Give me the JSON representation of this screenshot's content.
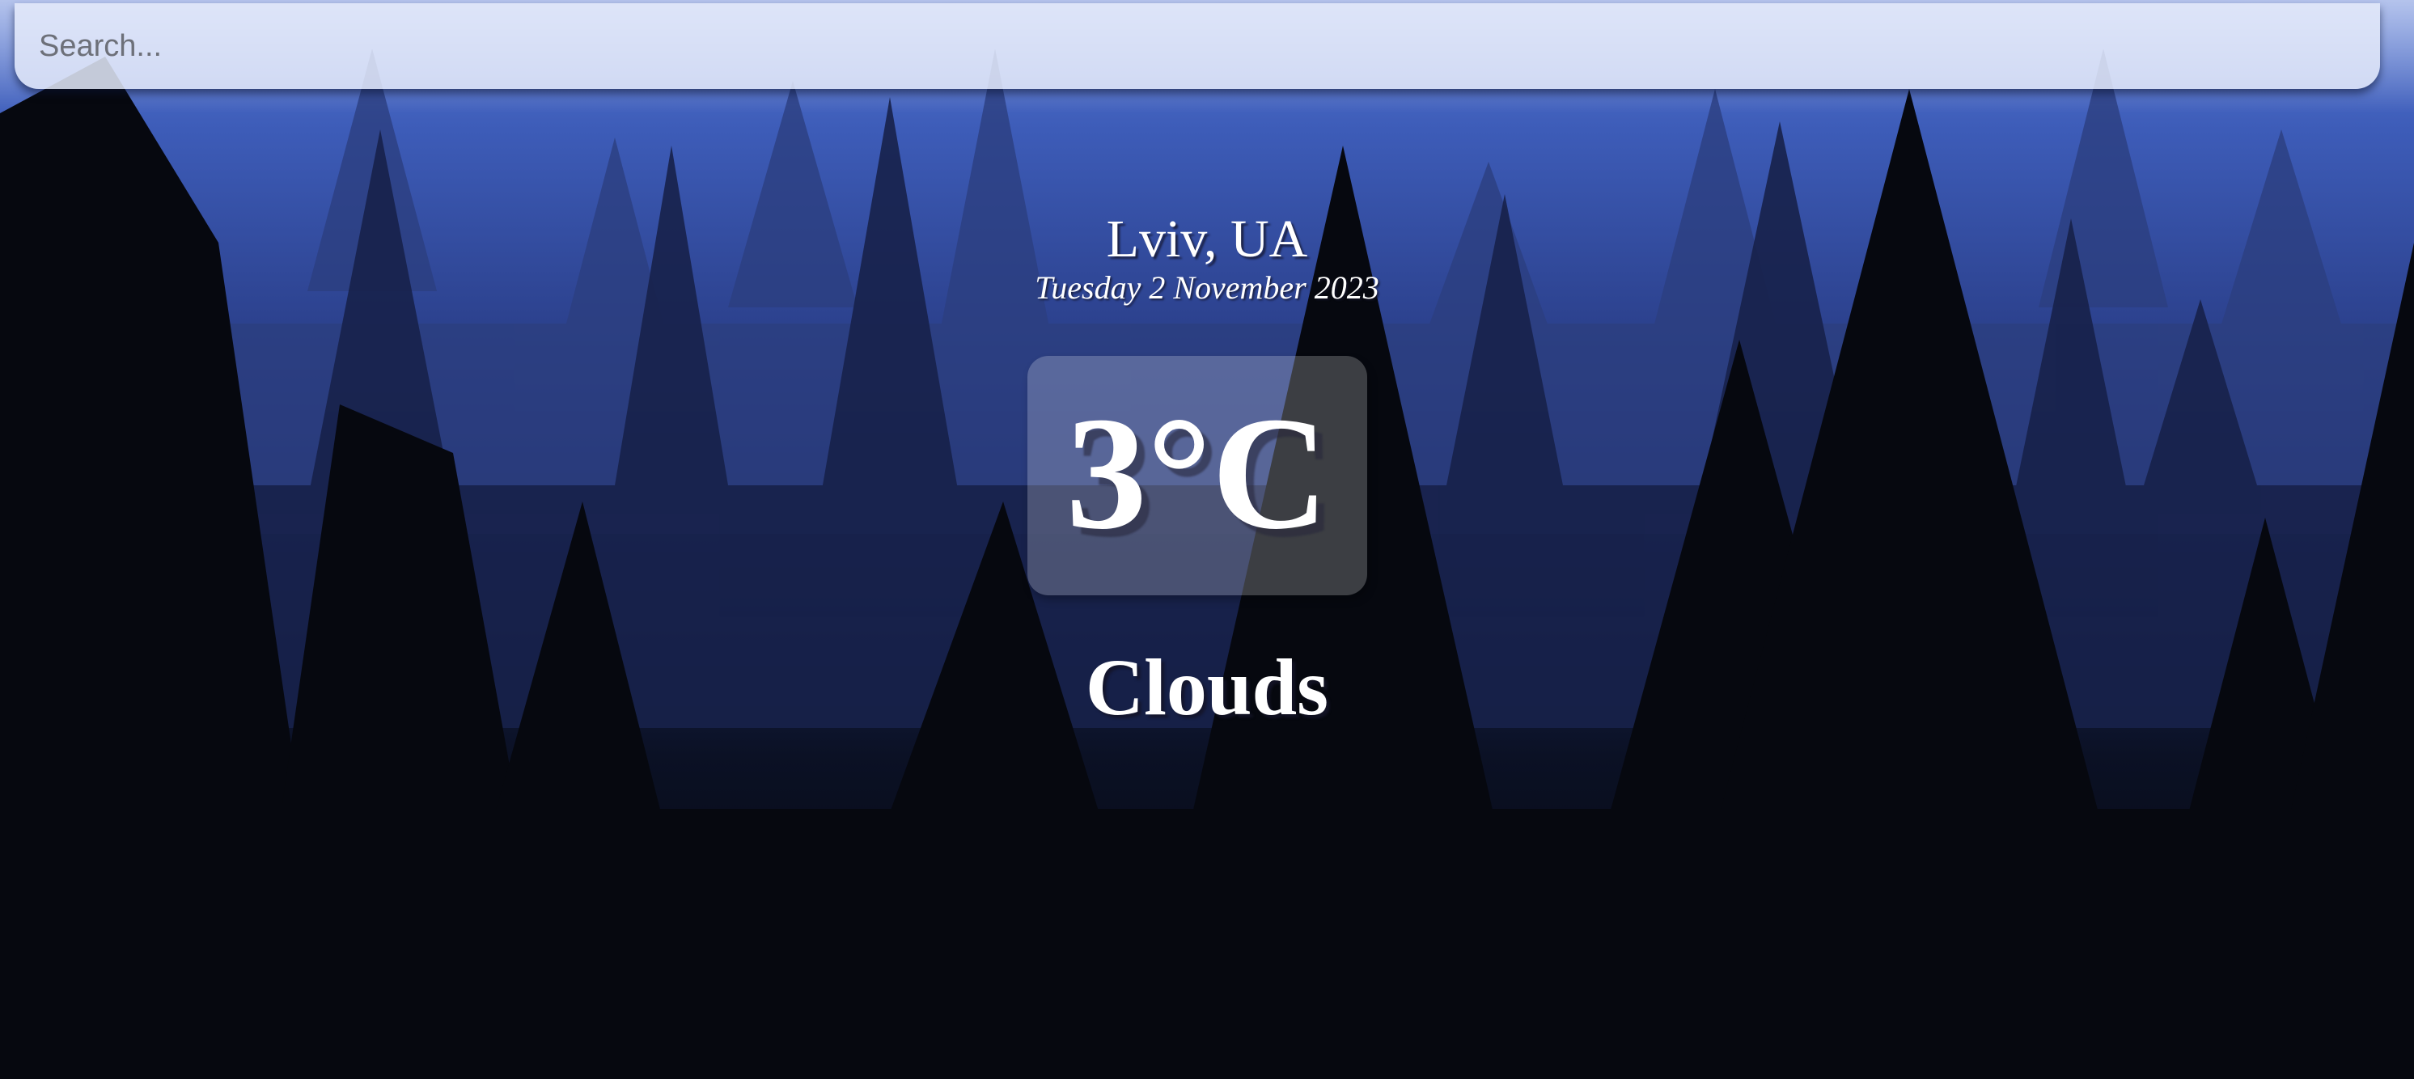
{
  "search": {
    "placeholder": "Search...",
    "value": ""
  },
  "weather": {
    "location": "Lviv, UA",
    "date": "Tuesday 2 November 2023",
    "temperature": "3°C",
    "condition": "Clouds"
  },
  "theme": {
    "sky_top": "#4a6ac4",
    "sky_mid": "#2c3f86",
    "ground": "#030407",
    "search_bg": "#e4eafa",
    "text_color": "#ffffff"
  }
}
